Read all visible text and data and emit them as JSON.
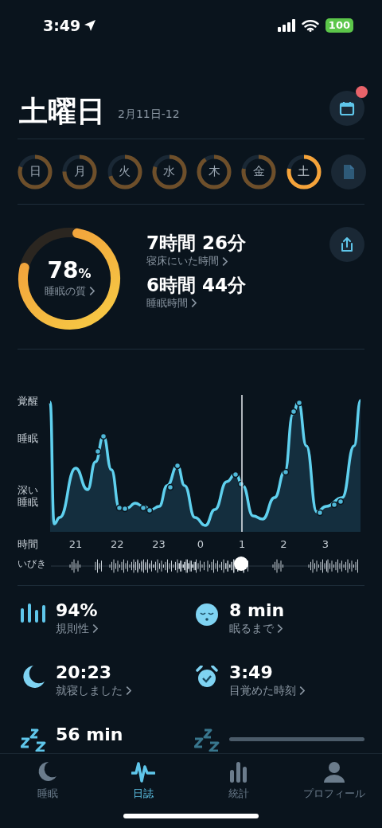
{
  "status_bar": {
    "time": "3:49",
    "battery": "100"
  },
  "header": {
    "title": "土曜日",
    "date": "2月11日-12",
    "calendar_badge": true
  },
  "days": [
    {
      "label": "日",
      "selected": false
    },
    {
      "label": "月",
      "selected": false
    },
    {
      "label": "火",
      "selected": false
    },
    {
      "label": "水",
      "selected": false
    },
    {
      "label": "木",
      "selected": false
    },
    {
      "label": "金",
      "selected": false
    },
    {
      "label": "土",
      "selected": true
    }
  ],
  "quality": {
    "value": "78",
    "unit": "%",
    "label": "睡眠の質"
  },
  "durations": [
    {
      "value": "7時間 26分",
      "label": "寝床にいた時間"
    },
    {
      "value": "6時間 44分",
      "label": "睡眠時間"
    }
  ],
  "chart": {
    "y_labels": [
      "覚醒",
      "睡眠",
      "深い睡眠"
    ],
    "time_label": "時間",
    "ticks": [
      "21",
      "22",
      "23",
      "0",
      "1",
      "2",
      "3"
    ],
    "snore_label": "いびき",
    "level": 0.62
  },
  "stats": [
    {
      "kind": "bars",
      "value": "94%",
      "label": "規則性"
    },
    {
      "kind": "face",
      "value": "8 min",
      "label": "眠るまで"
    },
    {
      "kind": "moon",
      "value": "20:23",
      "label": "就寝しました"
    },
    {
      "kind": "alarm",
      "value": "3:49",
      "label": "目覚めた時刻"
    },
    {
      "kind": "zzz",
      "value": "56 min"
    },
    {
      "kind": "zzz",
      "loading": true
    }
  ],
  "tabs": [
    {
      "kind": "moon",
      "label": "睡眠",
      "selected": false
    },
    {
      "kind": "wave",
      "label": "日誌",
      "selected": true
    },
    {
      "kind": "bars",
      "label": "統計",
      "selected": false
    },
    {
      "kind": "person",
      "label": "プロフィール",
      "selected": false
    }
  ]
}
